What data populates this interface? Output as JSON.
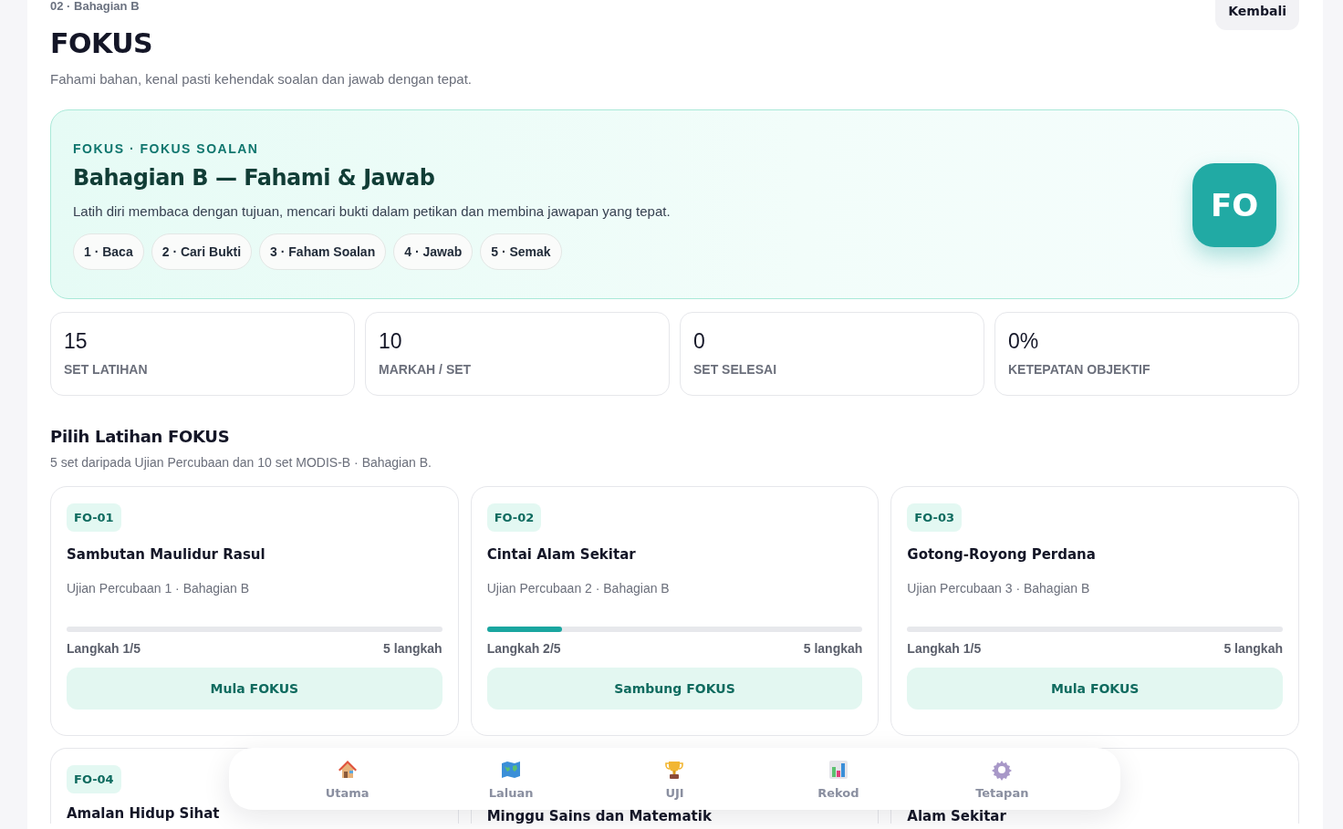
{
  "breadcrumb": "02 · Bahagian B",
  "back_button": "Kembali",
  "title": "FOKUS",
  "subtitle": "Fahami bahan, kenal pasti kehendak soalan dan jawab dengan tepat.",
  "hero": {
    "eyebrow": "FOKUS · FOKUS SOALAN",
    "heading": "Bahagian B — Fahami & Jawab",
    "description": "Latih diri membaca dengan tujuan, mencari bukti dalam petikan dan membina jawapan yang tepat.",
    "badge": "FO",
    "steps": [
      "1 · Baca",
      "2 · Cari Bukti",
      "3 · Faham Soalan",
      "4 · Jawab",
      "5 · Semak"
    ]
  },
  "stats": [
    {
      "value": "15",
      "label": "SET LATIHAN"
    },
    {
      "value": "10",
      "label": "MARKAH / SET"
    },
    {
      "value": "0",
      "label": "SET SELESAI"
    },
    {
      "value": "0%",
      "label": "KETEPATAN OBJEKTIF"
    }
  ],
  "section": {
    "heading": "Pilih Latihan FOKUS",
    "description": "5 set daripada Ujian Percubaan dan 10 set MODIS-B · Bahagian B."
  },
  "sets": [
    {
      "code": "FO-01",
      "title": "Sambutan Maulidur Rasul",
      "source": "Ujian Percubaan 1 · Bahagian B",
      "level": 0,
      "step": "Langkah 1/5",
      "total": "5 langkah",
      "action": "Mula FOKUS"
    },
    {
      "code": "FO-02",
      "title": "Cintai Alam Sekitar",
      "source": "Ujian Percubaan 2 · Bahagian B",
      "level": 0.2,
      "step": "Langkah 2/5",
      "total": "5 langkah",
      "action": "Sambung FOKUS"
    },
    {
      "code": "FO-03",
      "title": "Gotong-Royong Perdana",
      "source": "Ujian Percubaan 3 · Bahagian B",
      "level": 0,
      "step": "Langkah 1/5",
      "total": "5 langkah",
      "action": "Mula FOKUS"
    },
    {
      "code": "FO-04",
      "title": "Amalan Hidup Sihat"
    },
    {
      "title": "Minggu Sains dan Matematik"
    },
    {
      "title": "Alam Sekitar"
    }
  ],
  "nav": [
    {
      "kind": "home",
      "label": "Utama"
    },
    {
      "kind": "map",
      "label": "Laluan"
    },
    {
      "kind": "trophy",
      "label": "UJI"
    },
    {
      "kind": "chart",
      "label": "Rekod"
    },
    {
      "kind": "gear",
      "label": "Tetapan"
    }
  ]
}
